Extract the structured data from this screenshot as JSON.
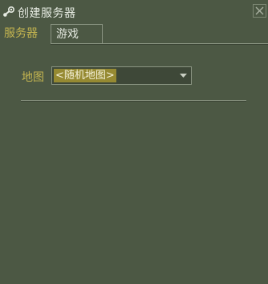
{
  "window": {
    "title": "创建服务器",
    "title_icon": "steam-logo-icon",
    "close_icon": "close-icon"
  },
  "tabs": [
    {
      "label": "服务器",
      "active": true
    },
    {
      "label": "游戏",
      "active": false
    }
  ],
  "map": {
    "label": "地图",
    "selected_value": "<随机地图>",
    "dropdown_icon": "chevron-down-icon"
  },
  "colors": {
    "background": "#4c5844",
    "accent_text": "#c4b550",
    "selection_highlight": "#968a32",
    "border": "#8a9482"
  }
}
